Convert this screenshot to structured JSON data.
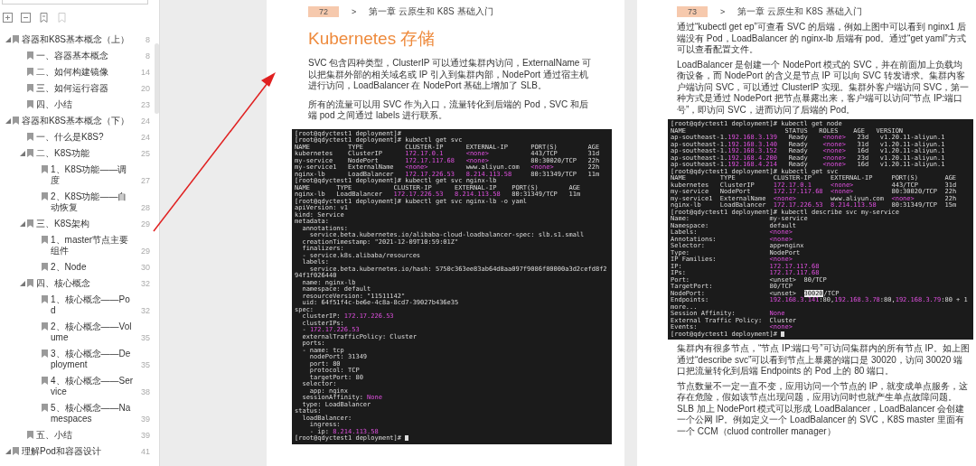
{
  "sidebar": {
    "outline": [
      {
        "title": "容器和K8S基本概念（上）",
        "page": "8",
        "expanded": true,
        "children": [
          {
            "title": "一、容器基本概念",
            "page": "8"
          },
          {
            "title": "二、如何构建镜像",
            "page": "14"
          },
          {
            "title": "三、如何运行容器",
            "page": "20"
          },
          {
            "title": "四、小结",
            "page": "23"
          }
        ]
      },
      {
        "title": "容器和K8S基本概念（下）",
        "page": "24",
        "expanded": true,
        "children": [
          {
            "title": "一、什么是K8S?",
            "page": "24"
          },
          {
            "title": "二、K8S功能",
            "page": "25",
            "expanded": true,
            "children": [
              {
                "title": "1、K8S功能——调度",
                "page": "27"
              },
              {
                "title": "2、K8S功能——自动恢复",
                "page": "28"
              }
            ]
          },
          {
            "title": "三、K8S架构",
            "page": "29",
            "expanded": true,
            "children": [
              {
                "title": "1、master节点主要组件",
                "page": "29"
              },
              {
                "title": "2、Node",
                "page": "30"
              }
            ]
          },
          {
            "title": "四、核心概念",
            "page": "32",
            "expanded": true,
            "children": [
              {
                "title": "1、核心概念——Pod",
                "page": "32"
              },
              {
                "title": "2、核心概念——Volume",
                "page": "35"
              },
              {
                "title": "3、核心概念——Deployment",
                "page": "35"
              },
              {
                "title": "4、核心概念——Service",
                "page": "38"
              },
              {
                "title": "5、核心概念——Namespaces",
                "page": "39"
              }
            ]
          },
          {
            "title": "五、小结",
            "page": "39"
          }
        ]
      },
      {
        "title": "理解Pod和容器设计",
        "page": "41",
        "expanded": true
      }
    ]
  },
  "pages": [
    {
      "number": "72",
      "separator": ">",
      "chapter": "第一章 云原生和 K8S 基础入门",
      "blocks": [
        {
          "kind": "title",
          "text": "Kubernetes 存储"
        },
        {
          "kind": "paragraph",
          "text": "SVC 包含四种类型，ClusterIP 可以通过集群内访问，ExternalName 可以把集群外部的相关域名或 IP 引入到集群内部，NodePort 通过宿主机进行访问，LoadBalancer 在 NodePort 基础上增加了 SLB。"
        },
        {
          "kind": "paragraph",
          "text": "所有的流量可以用 SVC 作为入口，流量转化到后端的 Pod，SVC 和后端 pod 之间通过 labels 进行联系。"
        },
        {
          "kind": "terminal",
          "lines": [
            [
              {
                "t": "[root@qdyctest1 deployment]#",
                "kind": "plain"
              }
            ],
            [
              {
                "t": "[root@qdyctest1 deployment]# kubectl get svc",
                "kind": "plain"
              }
            ],
            [
              {
                "t": "NAME          TYPE           CLUSTER-IP      EXTERNAL-IP      PORT(S)        AGE",
                "kind": "plain"
              }
            ],
            [
              {
                "t": "kubernetes    ClusterIP      ",
                "kind": "plain"
              },
              {
                "t": "172.17.0.1",
                "kind": "hl"
              },
              {
                "t": "      <none>",
                "kind": "hl"
              },
              {
                "t": "           443/TCP        31d",
                "kind": "plain"
              }
            ],
            [
              {
                "t": "my-service    NodePort       ",
                "kind": "plain"
              },
              {
                "t": "172.17.117.68",
                "kind": "hl"
              },
              {
                "t": "   <none>",
                "kind": "hl"
              },
              {
                "t": "           80:30020/TCP   22h",
                "kind": "plain"
              }
            ],
            [
              {
                "t": "my-service1   ExternalName   ",
                "kind": "plain"
              },
              {
                "t": "<none>",
                "kind": "hl"
              },
              {
                "t": "          www.aliyun.com   ",
                "kind": "plain"
              },
              {
                "t": "<none>",
                "kind": "hl"
              },
              {
                "t": "         22h",
                "kind": "plain"
              }
            ],
            [
              {
                "t": "nginx-lb      LoadBalancer   ",
                "kind": "plain"
              },
              {
                "t": "172.17.226.53",
                "kind": "hl"
              },
              {
                "t": "   8.214.113.58",
                "kind": "hl"
              },
              {
                "t": "     80:31349/TCP   11m",
                "kind": "plain"
              }
            ],
            [
              {
                "t": "[root@qdyctest1 deployment]# kubectl get svc nginx-lb",
                "kind": "plain"
              }
            ],
            [
              {
                "t": "NAME       TYPE           CLUSTER-IP      EXTERNAL-IP    PORT(S)        AGE",
                "kind": "plain"
              }
            ],
            [
              {
                "t": "nginx-lb   LoadBalancer   ",
                "kind": "plain"
              },
              {
                "t": "172.17.226.53",
                "kind": "hl"
              },
              {
                "t": "   8.214.113.58",
                "kind": "hl"
              },
              {
                "t": "   80:31349/TCP   11m",
                "kind": "plain"
              }
            ],
            [
              {
                "t": "[root@qdyctest1 deployment]# kubectl get svc nginx-lb -o yaml",
                "kind": "plain"
              }
            ],
            [
              {
                "t": "apiVersion: v1",
                "kind": "plain"
              }
            ],
            [
              {
                "t": "kind: Service",
                "kind": "plain"
              }
            ],
            [
              {
                "t": "metadata:",
                "kind": "plain"
              }
            ],
            [
              {
                "t": "  annotations:",
                "kind": "plain"
              }
            ],
            [
              {
                "t": "    service.beta.kubernetes.io/alibaba-cloud-loadbalancer-spec: slb.s1.small",
                "kind": "plain"
              }
            ],
            [
              {
                "t": "  creationTimestamp: \"2021-12-09T10:59:01Z\"",
                "kind": "plain"
              }
            ],
            [
              {
                "t": "  finalizers:",
                "kind": "plain"
              }
            ],
            [
              {
                "t": "  - service.k8s.alibaba/resources",
                "kind": "plain"
              }
            ],
            [
              {
                "t": "  labels:",
                "kind": "plain"
              }
            ],
            [
              {
                "t": "    service.beta.kubernetes.io/hash: 5750c363ee83ab64d8aa097f9086f80000a3d2cefd8f294f1f026440",
                "kind": "plain"
              }
            ],
            [
              {
                "t": "  name: nginx-lb",
                "kind": "plain"
              }
            ],
            [
              {
                "t": "  namespace: default",
                "kind": "plain"
              }
            ],
            [
              {
                "t": "  resourceVersion: \"11511142\"",
                "kind": "plain"
              }
            ],
            [
              {
                "t": "  uid: 64f51f4c-be6e-4c8a-8cd7-39027b436e35",
                "kind": "plain"
              }
            ],
            [
              {
                "t": "spec:",
                "kind": "plain"
              }
            ],
            [
              {
                "t": "  clusterIP: ",
                "kind": "plain"
              },
              {
                "t": "172.17.226.53",
                "kind": "hl"
              }
            ],
            [
              {
                "t": "  clusterIPs:",
                "kind": "plain"
              }
            ],
            [
              {
                "t": "  - ",
                "kind": "plain"
              },
              {
                "t": "172.17.226.53",
                "kind": "hl"
              }
            ],
            [
              {
                "t": "  externalTrafficPolicy: Cluster",
                "kind": "plain"
              }
            ],
            [
              {
                "t": "  ports:",
                "kind": "plain"
              }
            ],
            [
              {
                "t": "  - name: tcp",
                "kind": "plain"
              }
            ],
            [
              {
                "t": "    nodePort: 31349",
                "kind": "plain"
              }
            ],
            [
              {
                "t": "    port: 80",
                "kind": "plain"
              }
            ],
            [
              {
                "t": "    protocol: TCP",
                "kind": "plain"
              }
            ],
            [
              {
                "t": "    targetPort: 80",
                "kind": "plain"
              }
            ],
            [
              {
                "t": "  selector:",
                "kind": "plain"
              }
            ],
            [
              {
                "t": "    app: nginx",
                "kind": "plain"
              }
            ],
            [
              {
                "t": "  sessionAffinity: ",
                "kind": "plain"
              },
              {
                "t": "None",
                "kind": "hl"
              }
            ],
            [
              {
                "t": "  type: LoadBalancer",
                "kind": "plain"
              }
            ],
            [
              {
                "t": "status:",
                "kind": "plain"
              }
            ],
            [
              {
                "t": "  loadBalancer:",
                "kind": "plain"
              }
            ],
            [
              {
                "t": "    ingress:",
                "kind": "plain"
              }
            ],
            [
              {
                "t": "    - ip: ",
                "kind": "plain"
              },
              {
                "t": "8.214.113.58",
                "kind": "hl"
              }
            ],
            [
              {
                "t": "[root@qdyctest1 deployment]# ",
                "kind": "plain"
              },
              {
                "kind": "cursor"
              }
            ]
          ]
        }
      ]
    },
    {
      "number": "73",
      "separator": ">",
      "chapter": "第一章 云原生和 K8S 基础入门",
      "blocks": [
        {
          "kind": "paragraph",
          "text": "通过“kubectl get ep”可查看 SVC 的后端，例如上图中可以看到 nginx1 后端没有 Pod，LoadBalancer 的 nginx-lb 后端有 pod。通过“get yaml”方式可以查看配置文件。"
        },
        {
          "kind": "paragraph",
          "text": "LoadBalancer 是创建一个 NodePort 模式的 SVC，并在前面加上负载均衡设备，而 NodePort 的含义是节点 IP 可以向 SVC 转发请求。集群内客户端访问 SVC，可以通过 ClusterIP 实现。集群外客户端访问 SVC，第一种方式是通过 NodePort 把节点暴露出来，客户端可以访问“节点 IP:端口号”，即访问 SVC，进而访问了后端的 Pod。"
        },
        {
          "kind": "terminal",
          "lines": [
            [
              {
                "t": "[root@qdyctest1 deployment]# kubectl get node",
                "kind": "plain"
              }
            ],
            [
              {
                "t": "NAME                          STATUS   ROLES    AGE   VERSION",
                "kind": "plain"
              }
            ],
            [
              {
                "t": "ap-southeast-1.",
                "kind": "plain"
              },
              {
                "t": "192.168.3.139",
                "kind": "hl"
              },
              {
                "t": "   Ready    ",
                "kind": "plain"
              },
              {
                "t": "<none>",
                "kind": "hl"
              },
              {
                "t": "   23d   v1.20.11-aliyun.1",
                "kind": "plain"
              }
            ],
            [
              {
                "t": "ap-southeast-1.",
                "kind": "plain"
              },
              {
                "t": "192.168.3.140",
                "kind": "hl"
              },
              {
                "t": "   Ready    ",
                "kind": "plain"
              },
              {
                "t": "<none>",
                "kind": "hl"
              },
              {
                "t": "   31d   v1.20.11-aliyun.1",
                "kind": "plain"
              }
            ],
            [
              {
                "t": "ap-southeast-1.",
                "kind": "plain"
              },
              {
                "t": "192.168.3.152",
                "kind": "hl"
              },
              {
                "t": "   Ready    ",
                "kind": "plain"
              },
              {
                "t": "<none>",
                "kind": "hl"
              },
              {
                "t": "   16d   v1.20.11-aliyun.1",
                "kind": "plain"
              }
            ],
            [
              {
                "t": "ap-southeast-1.",
                "kind": "plain"
              },
              {
                "t": "192.168.4.200",
                "kind": "hl"
              },
              {
                "t": "   Ready    ",
                "kind": "plain"
              },
              {
                "t": "<none>",
                "kind": "hl"
              },
              {
                "t": "   23d   v1.20.11-aliyun.1",
                "kind": "plain"
              }
            ],
            [
              {
                "t": "ap-southeast-1.",
                "kind": "plain"
              },
              {
                "t": "192.168.4.214",
                "kind": "hl"
              },
              {
                "t": "   Ready    ",
                "kind": "plain"
              },
              {
                "t": "<none>",
                "kind": "hl"
              },
              {
                "t": "   16d   v1.20.11-aliyun.1",
                "kind": "plain"
              }
            ],
            [
              {
                "t": "[root@qdyctest1 deployment]# kubectl get svc",
                "kind": "plain"
              }
            ],
            [
              {
                "t": "NAME         TYPE          CLUSTER-IP     EXTERNAL-IP     PORT(S)       AGE",
                "kind": "plain"
              }
            ],
            [
              {
                "t": "kubernetes   ClusterIP     ",
                "kind": "plain"
              },
              {
                "t": "172.17.0.1",
                "kind": "hl"
              },
              {
                "t": "     <none>",
                "kind": "hl"
              },
              {
                "t": "          443/TCP       31d",
                "kind": "plain"
              }
            ],
            [
              {
                "t": "my-service   NodePort      ",
                "kind": "plain"
              },
              {
                "t": "172.17.117.68",
                "kind": "hl"
              },
              {
                "t": "  <none>",
                "kind": "hl"
              },
              {
                "t": "          80:30020/TCP  22h",
                "kind": "plain"
              }
            ],
            [
              {
                "t": "my-service1  ExternalName  ",
                "kind": "plain"
              },
              {
                "t": "<none>",
                "kind": "hl"
              },
              {
                "t": "         www.aliyun.com  ",
                "kind": "plain"
              },
              {
                "t": "<none>",
                "kind": "hl"
              },
              {
                "t": "        22h",
                "kind": "plain"
              }
            ],
            [
              {
                "t": "nginx-lb     LoadBalancer  ",
                "kind": "plain"
              },
              {
                "t": "172.17.226.53",
                "kind": "hl"
              },
              {
                "t": "  8.214.113.58",
                "kind": "hl"
              },
              {
                "t": "    80:31349/TCP  15m",
                "kind": "plain"
              }
            ],
            [
              {
                "t": "[root@qdyctest1 deployment]# kubectl describe svc my-service",
                "kind": "plain"
              }
            ],
            [
              {
                "t": "Name:                     my-service",
                "kind": "plain"
              }
            ],
            [
              {
                "t": "Namespace:                default",
                "kind": "plain"
              }
            ],
            [
              {
                "t": "Labels:                   ",
                "kind": "plain"
              },
              {
                "t": "<none>",
                "kind": "hl"
              }
            ],
            [
              {
                "t": "Annotations:              ",
                "kind": "plain"
              },
              {
                "t": "<none>",
                "kind": "hl"
              }
            ],
            [
              {
                "t": "Selector:                 app=nginx",
                "kind": "plain"
              }
            ],
            [
              {
                "t": "Type:                     NodePort",
                "kind": "plain"
              }
            ],
            [
              {
                "t": "IP Families:              ",
                "kind": "plain"
              },
              {
                "t": "<none>",
                "kind": "hl"
              }
            ],
            [
              {
                "t": "IP:                       ",
                "kind": "plain"
              },
              {
                "t": "172.17.117.68",
                "kind": "hl"
              }
            ],
            [
              {
                "t": "IPs:                      ",
                "kind": "plain"
              },
              {
                "t": "172.17.117.68",
                "kind": "hl"
              }
            ],
            [
              {
                "t": "Port:                     <unset>  80/TCP",
                "kind": "plain"
              }
            ],
            [
              {
                "t": "TargetPort:               80/TCP",
                "kind": "plain"
              }
            ],
            [
              {
                "t": "NodePort:                 <unset>  ",
                "kind": "plain"
              },
              {
                "t": "30020",
                "kind": "sel"
              },
              {
                "t": "/TCP",
                "kind": "plain"
              }
            ],
            [
              {
                "t": "Endpoints:                ",
                "kind": "plain"
              },
              {
                "t": "192.168.3.141",
                "kind": "hl"
              },
              {
                "t": ":80,",
                "kind": "plain"
              },
              {
                "t": "192.168.3.78",
                "kind": "hl"
              },
              {
                "t": ":80,",
                "kind": "plain"
              },
              {
                "t": "192.168.3.79",
                "kind": "hl"
              },
              {
                "t": ":80 + 1 more...",
                "kind": "plain"
              }
            ],
            [
              {
                "t": "Session Affinity:         ",
                "kind": "plain"
              },
              {
                "t": "None",
                "kind": "hl"
              }
            ],
            [
              {
                "t": "External Traffic Policy:  Cluster",
                "kind": "plain"
              }
            ],
            [
              {
                "t": "Events:                   ",
                "kind": "plain"
              },
              {
                "t": "<none>",
                "kind": "hl"
              }
            ],
            [
              {
                "t": "[root@qdyctest1 deployment]# ",
                "kind": "plain"
              },
              {
                "kind": "cursor"
              }
            ]
          ]
        },
        {
          "kind": "paragraph",
          "text": "集群内有很多节点，“节点 IP:端口号”可访问集群内的所有节点 IP。如上图通过“describe svc”可以看到节点上暴露的端口是 30020，访问 30020 端口把流量转化到后端 Endpoints 的 Pod 上的 80 端口。"
        },
        {
          "kind": "paragraph",
          "text": "节点数量不一定一直不变，应用访问一个节点的 IP，就变成单点服务，这存在危险，假如该节点出现问题，应用访问时也就产生单点故障问题。SLB 加上 NodePort 模式可以形成 LoadBalancer，LoadBalancer 会创建一个公网 IP。例如定义一个 LoadBalancer 的 SVC，K8S master 里面有一个 CCM（cluod controller manager）"
        }
      ]
    }
  ]
}
